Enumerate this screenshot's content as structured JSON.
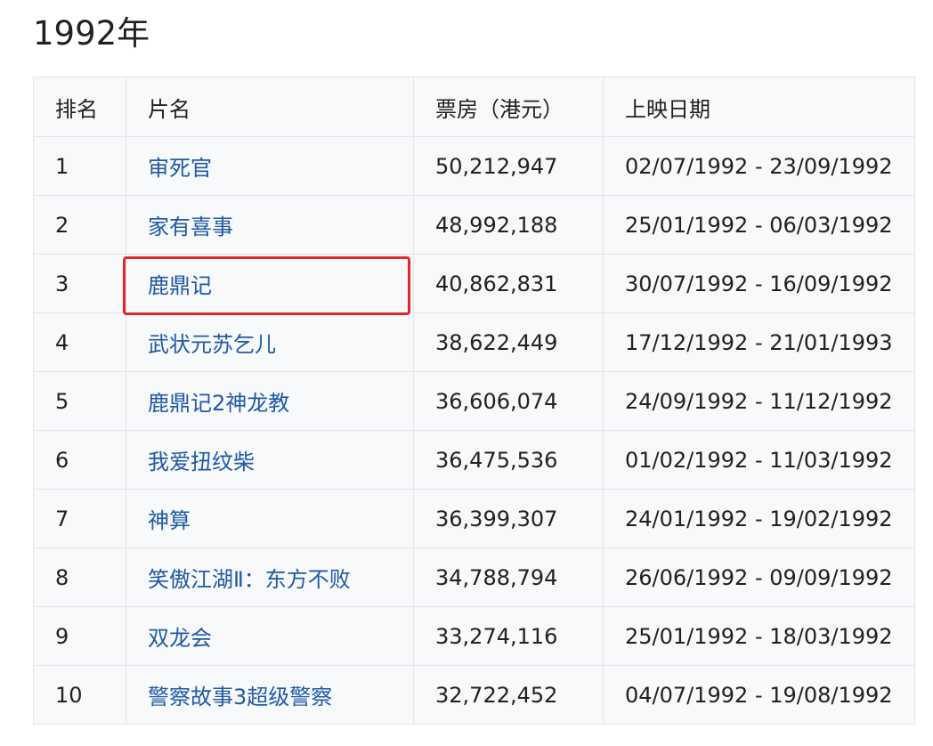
{
  "page": {
    "title": "1992年"
  },
  "table": {
    "headers": {
      "rank": "排名",
      "title": "片名",
      "gross": "票房（港元）",
      "release": "上映日期"
    },
    "rows": [
      {
        "rank": "1",
        "title": "审死官",
        "gross": "50,212,947",
        "release": "02/07/1992 - 23/09/1992"
      },
      {
        "rank": "2",
        "title": "家有喜事",
        "gross": "48,992,188",
        "release": "25/01/1992 - 06/03/1992"
      },
      {
        "rank": "3",
        "title": "鹿鼎记",
        "gross": "40,862,831",
        "release": "30/07/1992 - 16/09/1992"
      },
      {
        "rank": "4",
        "title": "武状元苏乞儿",
        "gross": "38,622,449",
        "release": "17/12/1992 - 21/01/1993"
      },
      {
        "rank": "5",
        "title": "鹿鼎记2神龙教",
        "gross": "36,606,074",
        "release": "24/09/1992 - 11/12/1992"
      },
      {
        "rank": "6",
        "title": "我爱扭纹柴",
        "gross": "36,475,536",
        "release": "01/02/1992 - 11/03/1992"
      },
      {
        "rank": "7",
        "title": "神算",
        "gross": "36,399,307",
        "release": "24/01/1992 - 19/02/1992"
      },
      {
        "rank": "8",
        "title": "笑傲江湖Ⅱ：东方不败",
        "gross": "34,788,794",
        "release": "26/06/1992 - 09/09/1992"
      },
      {
        "rank": "9",
        "title": "双龙会",
        "gross": "33,274,116",
        "release": "25/01/1992 - 18/03/1992"
      },
      {
        "rank": "10",
        "title": "警察故事3超级警察",
        "gross": "32,722,452",
        "release": "04/07/1992 - 19/08/1992"
      }
    ]
  },
  "highlight": {
    "row_rank": "3",
    "color": "#e0262b"
  },
  "colors": {
    "link": "#1f5aa6",
    "table_bg": "#f8f9fa",
    "border": "#e3e5e8"
  }
}
